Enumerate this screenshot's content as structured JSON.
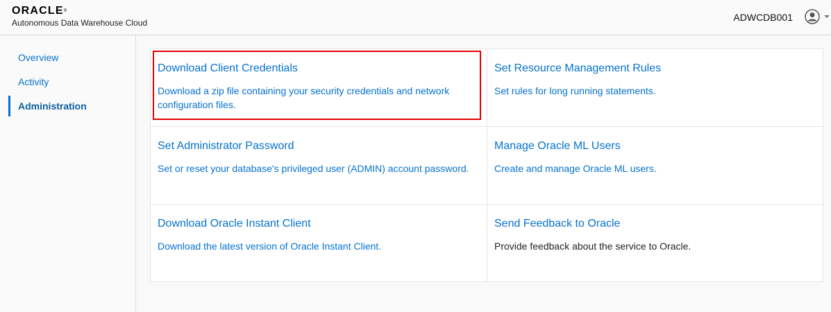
{
  "header": {
    "logo": "ORACLE",
    "logo_mark": "®",
    "subtitle": "Autonomous Data Warehouse Cloud",
    "db_name": "ADWCDB001",
    "user_icon": "user-circle-icon",
    "caret_icon": "chevron-down-icon"
  },
  "sidebar": {
    "items": [
      {
        "label": "Overview",
        "active": false
      },
      {
        "label": "Activity",
        "active": false
      },
      {
        "label": "Administration",
        "active": true
      }
    ]
  },
  "cards": [
    {
      "title": "Download Client Credentials",
      "desc": "Download a zip file containing your security credentials and network configuration files.",
      "highlighted": true
    },
    {
      "title": "Set Resource Management Rules",
      "desc": "Set rules for long running statements."
    },
    {
      "title": "Set Administrator Password",
      "desc": "Set or reset your database's privileged user (ADMIN) account password."
    },
    {
      "title": "Manage Oracle ML Users",
      "desc": "Create and manage Oracle ML users."
    },
    {
      "title": "Download Oracle Instant Client",
      "desc": "Download the latest version of Oracle Instant Client."
    },
    {
      "title": "Send Feedback to Oracle",
      "desc": "Provide feedback about the service to Oracle."
    }
  ],
  "colors": {
    "link": "#0572ce",
    "highlight": "#e00000"
  }
}
